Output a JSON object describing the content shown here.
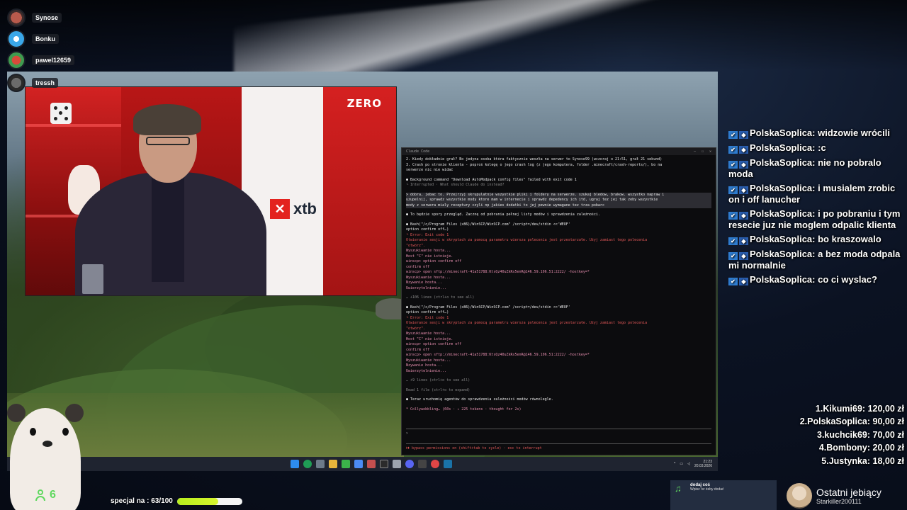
{
  "voice_chat": {
    "users": [
      "Synose",
      "Bonku",
      "pawel12659"
    ],
    "streamer": "tressh"
  },
  "video": {
    "channel_logo": "ZERO",
    "sponsor_logo": "xtb"
  },
  "terminal": {
    "title": "Claude Code",
    "lines": [
      {
        "cls": "t-white",
        "text": "2. Kiedy dokładnie grał? Bo jedyna osoba która faktycznie weszła na serwer to Synose99 (wczoraj o 21:51, grał 21 sekund)"
      },
      {
        "cls": "t-white",
        "text": "3. Crash po stronie klienta - poproś kolegę o jego crash log (z jego komputera, folder .minecraft/crash-reports/), bo na"
      },
      {
        "cls": "t-white",
        "text": "   serwerze nic nie widać"
      },
      {
        "cls": "gap",
        "text": ""
      },
      {
        "cls": "t-white",
        "text": "● Background command \"Download AutoModpack config files\" failed with exit code 1"
      },
      {
        "cls": "t-dim",
        "text": "  └ Interrupted · What should Claude do instead?"
      },
      {
        "cls": "gap",
        "text": ""
      },
      {
        "cls": "t-hl",
        "text": "> dobra, jebac to. Przejrzyj skrupulatnie wszystkie pliki i foldery na serwerze. szukaj bledow, brakow. wszystko napraw i"
      },
      {
        "cls": "t-hl",
        "text": "  uzupelnij, sprawdz wszystkie mody ktore mam w internecie i sprawdz depedency ich itd, ugraj tez jej tak zeby wszystkie"
      },
      {
        "cls": "t-hl",
        "text": "  mody z serwera mialy receptury czyli np jakies dodatki to jej pewnie wymagane tez trza pobarc"
      },
      {
        "cls": "gap",
        "text": ""
      },
      {
        "cls": "t-white",
        "text": "● To będzie spory przegląd. Zacznę od pobrania pełnej listy modów i sprawdzenia zależności."
      },
      {
        "cls": "gap",
        "text": ""
      },
      {
        "cls": "t-white",
        "text": "● Bash(\"/c/Program Files (x86)/WinSCP/WinSCP.com\" /script=/dev/stdin <<'WEOF'"
      },
      {
        "cls": "t-white",
        "text": "      option confirm off…)"
      },
      {
        "cls": "t-red",
        "text": "  └ Error: Exit code 1"
      },
      {
        "cls": "t-red",
        "text": "    Otwieranie sesji w skryptach za pomocą parametru wiersza polecenia jest przestarzałe. Użyj zamiast tego polecenia"
      },
      {
        "cls": "t-red",
        "text": "    \"otwórz\"."
      },
      {
        "cls": "t-pink",
        "text": "    Wyszukiwanie hosta..."
      },
      {
        "cls": "t-pink",
        "text": "    Host \"C\" nie istnieje."
      },
      {
        "cls": "t-pink",
        "text": "    winscp> option confirm off"
      },
      {
        "cls": "t-pink",
        "text": "    confirm         off"
      },
      {
        "cls": "t-pink",
        "text": "    winscp> open sftp://minecraft-41a51788:KtsQz40uZkRx5enR@146.59.106.51:2222/ -hostkey=*"
      },
      {
        "cls": "t-pink",
        "text": "    Wyszukiwanie hosta..."
      },
      {
        "cls": "t-pink",
        "text": "    Nzywanie hosta..."
      },
      {
        "cls": "t-pink",
        "text": "    Uwierzytelnienie..."
      },
      {
        "cls": "gap",
        "text": ""
      },
      {
        "cls": "t-dim",
        "text": "    … +106 lines (ctrl+o to see all)"
      },
      {
        "cls": "gap",
        "text": ""
      },
      {
        "cls": "t-white",
        "text": "● Bash(\"/c/Program Files (x86)/WinSCP/WinSCP.com\" /script=/dev/stdin <<'WEOF'"
      },
      {
        "cls": "t-white",
        "text": "      option confirm off…)"
      },
      {
        "cls": "t-red",
        "text": "  └ Error: Exit code 1"
      },
      {
        "cls": "t-red",
        "text": "    Otwieranie sesji w skryptach za pomocą parametru wiersza polecenia jest przestarzałe. Użyj zamiast tego polecenia"
      },
      {
        "cls": "t-red",
        "text": "    \"otwórz\"."
      },
      {
        "cls": "t-pink",
        "text": "    Wyszukiwanie hosta..."
      },
      {
        "cls": "t-pink",
        "text": "    Host \"C\" nie istnieje."
      },
      {
        "cls": "t-pink",
        "text": "    winscp> option confirm off"
      },
      {
        "cls": "t-pink",
        "text": "    confirm         off"
      },
      {
        "cls": "t-pink",
        "text": "    winscp> open sftp://minecraft-41a51788:KtsQz40uZkRx5enR@146.59.106.51:2222/ -hostkey=*"
      },
      {
        "cls": "t-pink",
        "text": "    Wyszukiwanie hosta..."
      },
      {
        "cls": "t-pink",
        "text": "    Nzywanie hosta..."
      },
      {
        "cls": "t-pink",
        "text": "    Uwierzytelnienie..."
      },
      {
        "cls": "gap",
        "text": ""
      },
      {
        "cls": "t-dim",
        "text": "    … +9 lines (ctrl+o to see all)"
      },
      {
        "cls": "gap",
        "text": ""
      },
      {
        "cls": "t-dim",
        "text": "  Read 1 file (ctrl+o to expand)"
      },
      {
        "cls": "gap",
        "text": ""
      },
      {
        "cls": "t-white",
        "text": "● Teraz uruchomię agentów do sprawdzenia zależności modów równolegle."
      },
      {
        "cls": "gap",
        "text": ""
      },
      {
        "cls": "t-pink",
        "text": "* Collywobbling… (60s · ↓ 225 tokens · thought for 2s)"
      }
    ],
    "prompt_hint": "⏵⏵ bypass permissions on (shift+tab to cycle) · esc to interrupt"
  },
  "taskbar": {
    "time": "21:23",
    "date": "20.03.2026"
  },
  "chat": {
    "messages": [
      {
        "user": "PolskaSoplica",
        "text": "widzowie wrócili"
      },
      {
        "user": "PolskaSoplica",
        "text": ":c"
      },
      {
        "user": "PolskaSoplica",
        "text": "nie no pobralo moda"
      },
      {
        "user": "PolskaSoplica",
        "text": "i musialem zrobic on i off lanucher"
      },
      {
        "user": "PolskaSoplica",
        "text": "i po pobraniu i tym resecie juz nie moglem odpalic klienta"
      },
      {
        "user": "PolskaSoplica",
        "text": "bo kraszowalo"
      },
      {
        "user": "PolskaSoplica",
        "text": "a bez moda odpala mi normalnie"
      },
      {
        "user": "PolskaSoplica",
        "text": "co ci wyslac?"
      }
    ]
  },
  "donations": [
    "1.Kikumi69: 120,00 zł",
    "2.PolskaSoplica: 90,00 zł",
    "3.kuchcik69: 70,00 zł",
    "4.Bombony: 20,00 zł",
    "5.Justynka: 18,00 zł"
  ],
  "viewers": "6",
  "goal": {
    "label": "specjal na : 63/100",
    "progress": 0.63
  },
  "music": {
    "title": "dodaj coś",
    "subtitle": "Wpisz !sr żeby dodać"
  },
  "last_sub": {
    "title": "Ostatni jebiący",
    "name": "Starkiller200111"
  },
  "colors": {
    "chat_badge": "#2f7dd1",
    "goal_fill": "#c6f122",
    "viewer_green": "#5fd85f"
  }
}
